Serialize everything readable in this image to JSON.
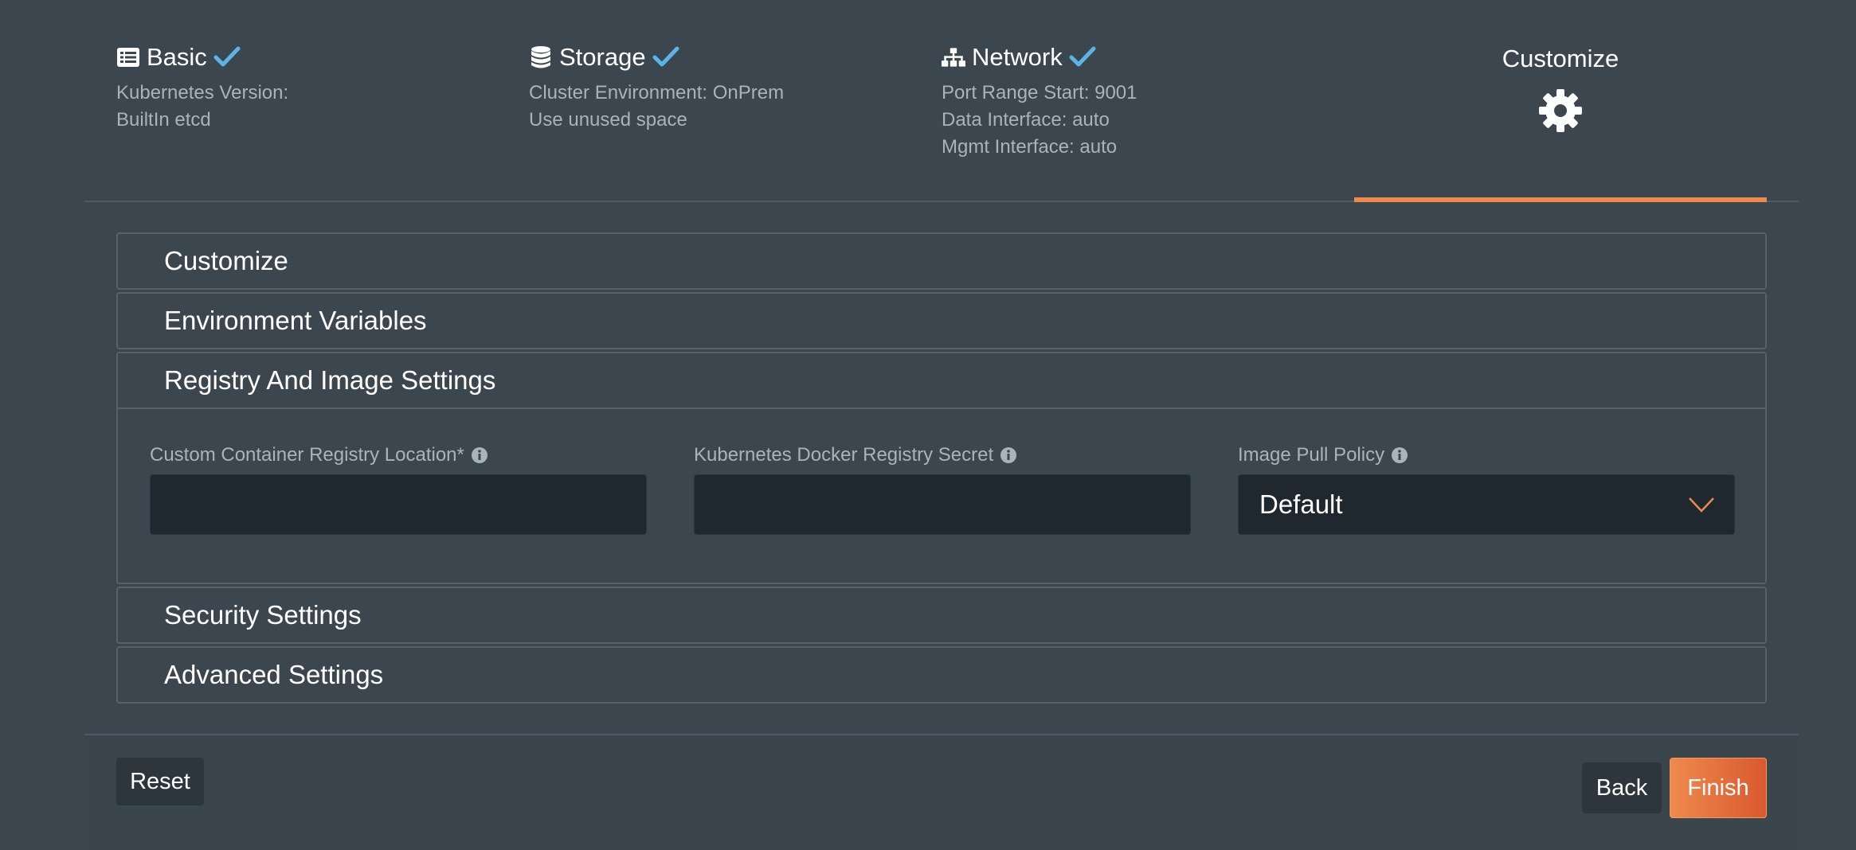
{
  "wizard": {
    "steps": [
      {
        "title": "Basic",
        "icon": "list-icon",
        "completed": true,
        "details": [
          "Kubernetes Version:",
          "BuiltIn etcd"
        ]
      },
      {
        "title": "Storage",
        "icon": "database-icon",
        "completed": true,
        "details": [
          "Cluster Environment: OnPrem",
          "Use unused space"
        ]
      },
      {
        "title": "Network",
        "icon": "sitemap-icon",
        "completed": true,
        "details": [
          "Port Range Start: 9001",
          "Data Interface: auto",
          "Mgmt Interface: auto"
        ]
      },
      {
        "title": "Customize",
        "icon": "gear-icon",
        "active": true
      }
    ],
    "check_color": "#5bb4e5",
    "active_color": "#ef8a4d"
  },
  "accordion": {
    "panels": [
      {
        "title": "Customize"
      },
      {
        "title": "Environment Variables"
      },
      {
        "title": "Registry And Image Settings",
        "open": true
      },
      {
        "title": "Security Settings"
      },
      {
        "title": "Advanced Settings"
      }
    ],
    "registry": {
      "container_registry_label": "Custom Container Registry Location*",
      "container_registry_value": "",
      "docker_secret_label": "Kubernetes Docker Registry Secret",
      "docker_secret_value": "",
      "pull_policy_label": "Image Pull Policy",
      "pull_policy_value": "Default"
    }
  },
  "footer": {
    "reset_label": "Reset",
    "back_label": "Back",
    "finish_label": "Finish"
  }
}
